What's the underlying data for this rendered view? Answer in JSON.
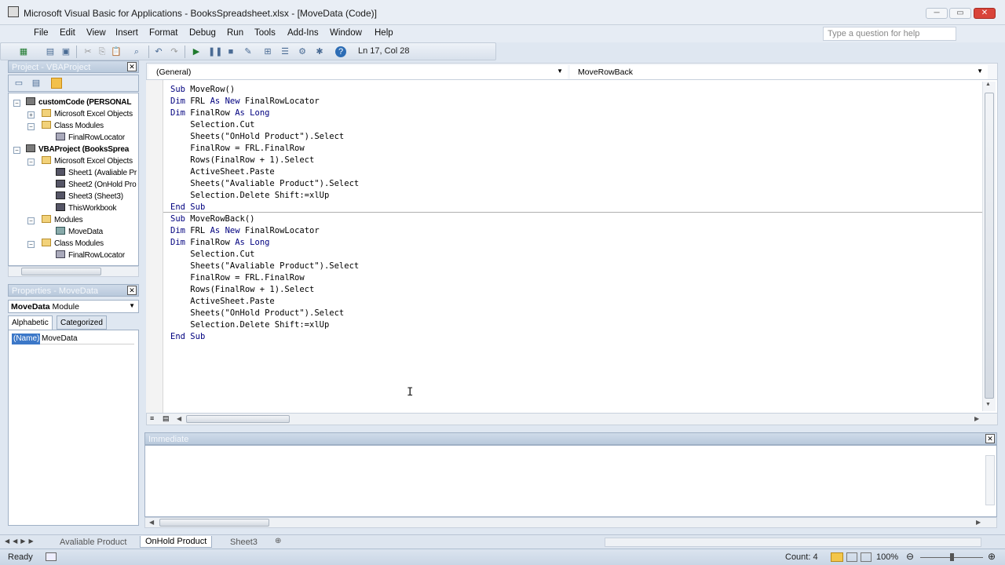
{
  "window": {
    "title": "Microsoft Visual Basic for Applications - BooksSpreadsheet.xlsx - [MoveData (Code)]",
    "controls": {
      "minimize": "─",
      "restore": "▭",
      "close": "✕"
    }
  },
  "menu": {
    "items": [
      "File",
      "Edit",
      "View",
      "Insert",
      "Format",
      "Debug",
      "Run",
      "Tools",
      "Add-Ins",
      "Window",
      "Help"
    ],
    "help_placeholder": "Type a question for help"
  },
  "toolbar": {
    "position": "Ln 17, Col 28"
  },
  "project_panel": {
    "title": "Project - VBAProject",
    "tree": [
      {
        "label": "customCode (PERSONAL",
        "icon": "proj"
      },
      {
        "label": "Microsoft Excel Objects",
        "icon": "folder"
      },
      {
        "label": "Class Modules",
        "icon": "folder"
      },
      {
        "label": "FinalRowLocator",
        "icon": "cls"
      },
      {
        "label": "VBAProject (BooksSprea",
        "icon": "proj"
      },
      {
        "label": "Microsoft Excel Objects",
        "icon": "folder"
      },
      {
        "label": "Sheet1 (Avaliable Pr",
        "icon": "sheet"
      },
      {
        "label": "Sheet2 (OnHold Pro",
        "icon": "sheet"
      },
      {
        "label": "Sheet3 (Sheet3)",
        "icon": "sheet"
      },
      {
        "label": "ThisWorkbook",
        "icon": "sheet"
      },
      {
        "label": "Modules",
        "icon": "folder"
      },
      {
        "label": "MoveData",
        "icon": "mod"
      },
      {
        "label": "Class Modules",
        "icon": "folder"
      },
      {
        "label": "FinalRowLocator",
        "icon": "cls"
      }
    ]
  },
  "properties_panel": {
    "title": "Properties - MoveData",
    "object_name": "MoveData",
    "object_type": "Module",
    "tabs": [
      "Alphabetic",
      "Categorized"
    ],
    "rows": [
      {
        "name": "(Name)",
        "value": "MoveData"
      }
    ]
  },
  "code_window": {
    "object_combo": "(General)",
    "procedure_combo": "MoveRowBack",
    "lines": [
      "Sub MoveRow()",
      "Dim FRL As New FinalRowLocator",
      "Dim FinalRow As Long",
      "    Selection.Cut",
      "    Sheets(\"OnHold Product\").Select",
      "    FinalRow = FRL.FinalRow",
      "    Rows(FinalRow + 1).Select",
      "    ActiveSheet.Paste",
      "    Sheets(\"Avaliable Product\").Select",
      "    Selection.Delete Shift:=xlUp",
      "End Sub",
      "Sub MoveRowBack()",
      "Dim FRL As New FinalRowLocator",
      "Dim FinalRow As Long",
      "    Selection.Cut",
      "    Sheets(\"Avaliable Product\").Select",
      "    FinalRow = FRL.FinalRow",
      "    Rows(FinalRow + 1).Select",
      "    ActiveSheet.Paste",
      "    Sheets(\"OnHold Product\").Select",
      "    Selection.Delete Shift:=xlUp",
      "End Sub"
    ]
  },
  "immediate": {
    "title": "Immediate"
  },
  "sheet_tabs": [
    "Avaliable Product",
    "OnHold Product",
    "Sheet3"
  ],
  "status": {
    "ready": "Ready",
    "count": "Count: 4",
    "zoom": "100%"
  }
}
